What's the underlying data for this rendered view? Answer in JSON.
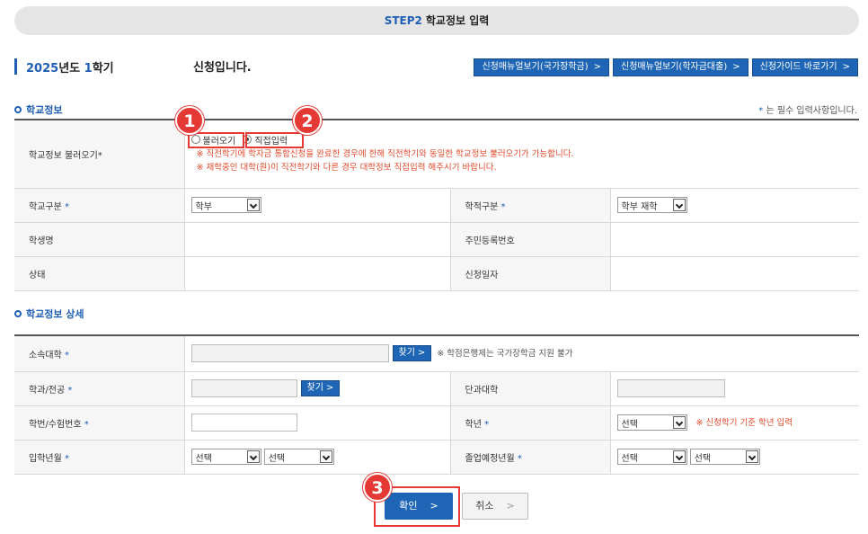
{
  "step_bar": {
    "step": "STEP2",
    "title": "학교정보 입력"
  },
  "semester": {
    "year": "2025",
    "year_suffix": "년도",
    "term": "1",
    "term_suffix": "학기",
    "apply_text": "신청입니다."
  },
  "guide_buttons": [
    {
      "label": "신청매뉴얼보기(국가장학금)",
      "arrow": ">"
    },
    {
      "label": "신청매뉴얼보기(학자금대출)",
      "arrow": ">"
    },
    {
      "label": "신청가이드 바로가기",
      "arrow": ">"
    }
  ],
  "school_info": {
    "section_title": "학교정보",
    "required_note_star": "*",
    "required_note": "는 필수 입력사항입니다.",
    "load_label": "학교정보 불러오기",
    "load_label_star": "*",
    "radio_load": "불러오기",
    "radio_direct": "직접입력",
    "selected_radio": "직접입력",
    "notice1": "※ 직전학기에 학자금 통합신청을 완료한 경우에 한해 직전학기와 동일한 학교정보 불러오기가 가능합니다.",
    "notice2": "※ 재학중인 대학(원)이 직전학기와 다른 경우 대학정보 직접입력 해주시기 바랍니다.",
    "school_type_label": "학교구분",
    "school_type_value": "학부",
    "enroll_type_label": "학적구분",
    "enroll_type_value": "학부 재학",
    "student_name_label": "학생명",
    "rrn_label": "주민등록번호",
    "status_label": "상태",
    "apply_date_label": "신청일자",
    "star": "*"
  },
  "school_detail": {
    "section_title": "학교정보 상세",
    "univ_label": "소속대학",
    "find_label": "찾기",
    "find_arrow": ">",
    "univ_hint": "※ 학점은행제는 국가장학금 지원 불가",
    "dept_label": "학과/전공",
    "college_label": "단과대학",
    "student_no_label": "학번/수험번호",
    "grade_label": "학년",
    "grade_value": "선택",
    "grade_hint": "※ 신청학기 기준 학년 입력",
    "admission_label": "입학년월",
    "admission_year": "선택",
    "admission_month": "선택",
    "graduation_label": "졸업예정년월",
    "graduation_year": "선택",
    "graduation_month": "선택",
    "star": "*"
  },
  "actions": {
    "confirm": "확인",
    "cancel": "취소",
    "arrow": ">"
  },
  "annotations": {
    "badge1": "1",
    "badge2": "2",
    "badge3": "3",
    "color": "#e53935"
  },
  "colors": {
    "accent": "#1f65b5",
    "notice": "#e04a2c",
    "highlight": "#e53935"
  }
}
